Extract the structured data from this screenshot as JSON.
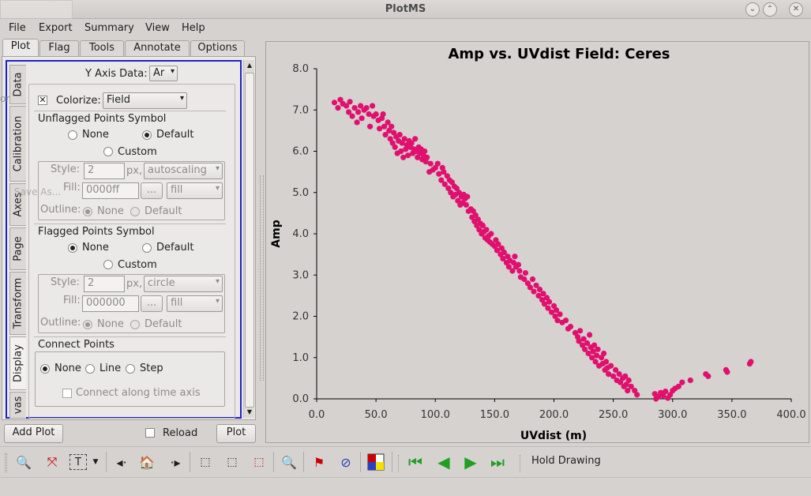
{
  "window": {
    "title": "PlotMS"
  },
  "menu": [
    "File",
    "Export",
    "Summary",
    "View",
    "Help"
  ],
  "top_tabs": [
    "Plot",
    "Flag",
    "Tools",
    "Annotate",
    "Options"
  ],
  "side_tabs": [
    "Data",
    "Calibration",
    "Axes",
    "Page",
    "Transform",
    "Display",
    "vas"
  ],
  "display": {
    "y_axis_label": "Y Axis Data:",
    "y_axis_value": "Ar",
    "colorize_label": "Colorize:",
    "colorize_value": "Field",
    "unflagged": {
      "title": "Unflagged Points Symbol",
      "none": "None",
      "default": "Default",
      "custom": "Custom",
      "style_label": "Style:",
      "size": "2",
      "px": "px,",
      "style_value": "autoscaling",
      "fill_label": "Fill:",
      "fill_value": "0000ff",
      "dots": "...",
      "fill_mode": "fill",
      "outline_label": "Outline:",
      "outline_none": "None",
      "outline_default": "Default"
    },
    "flagged": {
      "title": "Flagged Points Symbol",
      "none": "None",
      "default": "Default",
      "custom": "Custom",
      "style_label": "Style:",
      "size": "2",
      "px": "px,",
      "style_value": "circle",
      "fill_label": "Fill:",
      "fill_value": "000000",
      "dots": "...",
      "fill_mode": "fill",
      "outline_label": "Outline:",
      "outline_none": "None",
      "outline_default": "Default"
    },
    "connect": {
      "title": "Connect Points",
      "none": "None",
      "line": "Line",
      "step": "Step",
      "time_axis": "Connect along time axis"
    }
  },
  "bottom": {
    "add_plot": "Add Plot",
    "reload": "Reload",
    "plot": "Plot"
  },
  "toolbar": {
    "hold_drawing": "Hold Drawing"
  },
  "ghost": {
    "save_as": "Save As...",
    "or": "or"
  },
  "colors": {
    "points": "#e0106e",
    "selection_frame": "#1f23c9"
  },
  "chart_data": {
    "type": "scatter",
    "title": "Amp vs. UVdist Field: Ceres",
    "xlabel": "UVdist (m)",
    "ylabel": "Amp",
    "xlim": [
      0,
      400
    ],
    "ylim": [
      0,
      8
    ],
    "xticks": [
      "0.0",
      "50.0",
      "100.0",
      "150.0",
      "200.0",
      "250.0",
      "300.0",
      "350.0",
      "400.0"
    ],
    "yticks": [
      "0.0",
      "1.0",
      "2.0",
      "3.0",
      "4.0",
      "5.0",
      "6.0",
      "7.0",
      "8.0"
    ],
    "series": [
      {
        "color": "#e0106e",
        "points": [
          [
            15,
            7.18
          ],
          [
            18,
            7.05
          ],
          [
            20,
            7.25
          ],
          [
            22,
            7.15
          ],
          [
            25,
            7.1
          ],
          [
            27,
            6.95
          ],
          [
            28,
            7.2
          ],
          [
            30,
            6.85
          ],
          [
            32,
            7.05
          ],
          [
            34,
            6.7
          ],
          [
            35,
            6.95
          ],
          [
            37,
            7.1
          ],
          [
            38,
            6.8
          ],
          [
            40,
            7.0
          ],
          [
            42,
            7.05
          ],
          [
            44,
            6.9
          ],
          [
            45,
            6.6
          ],
          [
            47,
            7.1
          ],
          [
            48,
            6.85
          ],
          [
            50,
            6.9
          ],
          [
            52,
            6.75
          ],
          [
            53,
            6.55
          ],
          [
            55,
            6.8
          ],
          [
            56,
            6.9
          ],
          [
            57,
            6.6
          ],
          [
            58,
            6.4
          ],
          [
            60,
            6.7
          ],
          [
            61,
            6.5
          ],
          [
            62,
            6.3
          ],
          [
            63,
            6.6
          ],
          [
            64,
            6.2
          ],
          [
            65,
            6.45
          ],
          [
            66,
            6.1
          ],
          [
            67,
            6.35
          ],
          [
            68,
            5.95
          ],
          [
            69,
            6.25
          ],
          [
            70,
            6.4
          ],
          [
            71,
            6.0
          ],
          [
            72,
            6.2
          ],
          [
            73,
            5.85
          ],
          [
            74,
            6.3
          ],
          [
            75,
            6.05
          ],
          [
            76,
            6.15
          ],
          [
            77,
            5.9
          ],
          [
            78,
            6.25
          ],
          [
            79,
            6.1
          ],
          [
            80,
            6.2
          ],
          [
            81,
            5.95
          ],
          [
            82,
            6.05
          ],
          [
            83,
            6.3
          ],
          [
            84,
            6.0
          ],
          [
            85,
            5.85
          ],
          [
            86,
            6.1
          ],
          [
            87,
            5.95
          ],
          [
            88,
            6.05
          ],
          [
            89,
            5.8
          ],
          [
            90,
            5.9
          ],
          [
            91,
            6.0
          ],
          [
            92,
            5.75
          ],
          [
            93,
            5.85
          ],
          [
            95,
            5.5
          ],
          [
            96,
            5.7
          ],
          [
            98,
            5.55
          ],
          [
            100,
            5.6
          ],
          [
            102,
            5.7
          ],
          [
            103,
            5.45
          ],
          [
            105,
            5.3
          ],
          [
            106,
            5.6
          ],
          [
            107,
            5.5
          ],
          [
            108,
            5.2
          ],
          [
            110,
            5.4
          ],
          [
            111,
            5.1
          ],
          [
            112,
            5.3
          ],
          [
            113,
            5.0
          ],
          [
            114,
            5.25
          ],
          [
            115,
            4.9
          ],
          [
            116,
            5.15
          ],
          [
            117,
            4.95
          ],
          [
            118,
            5.1
          ],
          [
            119,
            4.8
          ],
          [
            120,
            5.0
          ],
          [
            121,
            4.7
          ],
          [
            122,
            4.9
          ],
          [
            123,
            4.75
          ],
          [
            124,
            4.95
          ],
          [
            125,
            4.85
          ],
          [
            126,
            4.7
          ],
          [
            127,
            4.9
          ],
          [
            128,
            4.55
          ],
          [
            130,
            4.6
          ],
          [
            131,
            4.4
          ],
          [
            132,
            4.55
          ],
          [
            133,
            4.3
          ],
          [
            134,
            4.45
          ],
          [
            135,
            4.2
          ],
          [
            136,
            4.35
          ],
          [
            137,
            4.1
          ],
          [
            138,
            4.25
          ],
          [
            139,
            4.0
          ],
          [
            140,
            4.2
          ],
          [
            141,
            4.05
          ],
          [
            142,
            3.9
          ],
          [
            143,
            4.1
          ],
          [
            144,
            3.85
          ],
          [
            145,
            3.95
          ],
          [
            146,
            3.8
          ],
          [
            147,
            4.0
          ],
          [
            148,
            3.75
          ],
          [
            150,
            3.7
          ],
          [
            151,
            3.85
          ],
          [
            152,
            3.6
          ],
          [
            153,
            3.75
          ],
          [
            155,
            3.5
          ],
          [
            156,
            3.65
          ],
          [
            157,
            3.4
          ],
          [
            158,
            3.55
          ],
          [
            160,
            3.3
          ],
          [
            161,
            3.45
          ],
          [
            162,
            3.2
          ],
          [
            163,
            3.35
          ],
          [
            165,
            3.1
          ],
          [
            166,
            3.3
          ],
          [
            167,
            3.45
          ],
          [
            168,
            3.2
          ],
          [
            170,
            3.25
          ],
          [
            171,
            3.1
          ],
          [
            172,
            2.95
          ],
          [
            175,
            2.9
          ],
          [
            176,
            3.05
          ],
          [
            178,
            2.8
          ],
          [
            180,
            2.7
          ],
          [
            182,
            2.9
          ],
          [
            183,
            2.6
          ],
          [
            185,
            2.75
          ],
          [
            187,
            2.5
          ],
          [
            188,
            2.65
          ],
          [
            190,
            2.4
          ],
          [
            191,
            2.55
          ],
          [
            192,
            2.3
          ],
          [
            194,
            2.45
          ],
          [
            195,
            2.2
          ],
          [
            196,
            2.35
          ],
          [
            198,
            2.1
          ],
          [
            200,
            2.25
          ],
          [
            201,
            2.0
          ],
          [
            202,
            2.15
          ],
          [
            203,
            1.9
          ],
          [
            205,
            2.05
          ],
          [
            207,
            1.85
          ],
          [
            210,
            1.9
          ],
          [
            212,
            1.7
          ],
          [
            214,
            1.75
          ],
          [
            218,
            1.6
          ],
          [
            220,
            1.5
          ],
          [
            221,
            1.4
          ],
          [
            222,
            1.65
          ],
          [
            224,
            1.3
          ],
          [
            225,
            1.45
          ],
          [
            226,
            1.2
          ],
          [
            228,
            1.35
          ],
          [
            229,
            1.1
          ],
          [
            230,
            1.55
          ],
          [
            231,
            1.25
          ],
          [
            232,
            1.0
          ],
          [
            233,
            1.15
          ],
          [
            234,
            1.3
          ],
          [
            235,
            0.9
          ],
          [
            236,
            1.05
          ],
          [
            237,
            1.2
          ],
          [
            238,
            0.8
          ],
          [
            240,
            1.0
          ],
          [
            241,
            0.85
          ],
          [
            242,
            1.1
          ],
          [
            243,
            0.7
          ],
          [
            244,
            0.9
          ],
          [
            245,
            0.75
          ],
          [
            246,
            0.6
          ],
          [
            248,
            0.8
          ],
          [
            250,
            0.55
          ],
          [
            252,
            0.7
          ],
          [
            253,
            0.45
          ],
          [
            255,
            0.6
          ],
          [
            256,
            0.4
          ],
          [
            258,
            0.5
          ],
          [
            259,
            0.3
          ],
          [
            260,
            0.55
          ],
          [
            261,
            0.35
          ],
          [
            262,
            0.2
          ],
          [
            263,
            0.45
          ],
          [
            265,
            0.3
          ],
          [
            268,
            0.2
          ],
          [
            270,
            0.1
          ],
          [
            285,
            0.12
          ],
          [
            286,
            0.0
          ],
          [
            288,
            0.05
          ],
          [
            290,
            0.15
          ],
          [
            292,
            0.08
          ],
          [
            294,
            0.18
          ],
          [
            296,
            0.02
          ],
          [
            298,
            0.1
          ],
          [
            300,
            0.2
          ],
          [
            302,
            0.25
          ],
          [
            305,
            0.3
          ],
          [
            308,
            0.4
          ],
          [
            315,
            0.45
          ],
          [
            328,
            0.6
          ],
          [
            330,
            0.55
          ],
          [
            345,
            0.7
          ],
          [
            346,
            0.65
          ],
          [
            365,
            0.85
          ],
          [
            366,
            0.9
          ]
        ]
      }
    ]
  }
}
